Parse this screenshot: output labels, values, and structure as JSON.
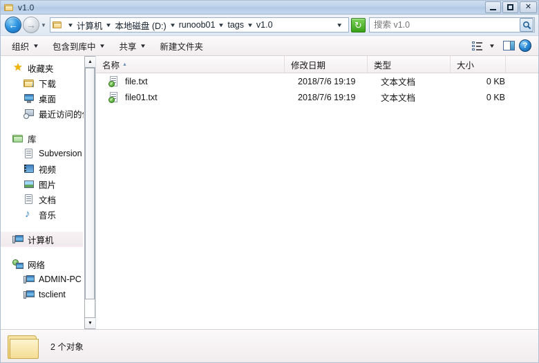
{
  "window": {
    "title": "v1.0",
    "title_icon": "folder-icon",
    "controls": {
      "minimize": "minimize-button",
      "maximize": "maximize-button",
      "close": "✕"
    }
  },
  "addressbar": {
    "back_label": "←",
    "forward_label": "→",
    "history_caret": "▼",
    "folder_icon": "folder-icon",
    "separator": "▼",
    "breadcrumbs": [
      "计算机",
      "本地磁盘 (D:)",
      "runoob01",
      "tags",
      "v1.0"
    ],
    "dropdown_caret": "▼",
    "refresh_label": "↻",
    "search": {
      "value": "",
      "placeholder": "搜索 v1.0",
      "button_icon": "search-icon"
    }
  },
  "toolbar": {
    "items": [
      {
        "label": "组织",
        "caret": "▼"
      },
      {
        "label": "包含到库中",
        "caret": "▼"
      },
      {
        "label": "共享",
        "caret": "▼"
      },
      {
        "label": "新建文件夹",
        "caret": ""
      }
    ],
    "view_caret": "▼",
    "help_label": "?"
  },
  "sidebar": {
    "groups": [
      {
        "head": {
          "label": "收藏夹",
          "icon": "star-icon"
        },
        "children": [
          {
            "label": "下载",
            "icon": "download-folder-icon"
          },
          {
            "label": "桌面",
            "icon": "desktop-icon"
          },
          {
            "label": "最近访问的位置",
            "icon": "recent-places-icon"
          }
        ]
      },
      {
        "head": {
          "label": "库",
          "icon": "library-folder-icon"
        },
        "children": [
          {
            "label": "Subversion",
            "icon": "document-icon"
          },
          {
            "label": "视频",
            "icon": "video-icon"
          },
          {
            "label": "图片",
            "icon": "picture-icon"
          },
          {
            "label": "文档",
            "icon": "document-icon"
          },
          {
            "label": "音乐",
            "icon": "music-icon"
          }
        ]
      },
      {
        "head": {
          "label": "计算机",
          "icon": "computer-icon",
          "selected": true
        },
        "children": []
      },
      {
        "head": {
          "label": "网络",
          "icon": "network-icon"
        },
        "children": [
          {
            "label": "ADMIN-PC",
            "icon": "computer-icon"
          },
          {
            "label": "tsclient",
            "icon": "computer-icon"
          }
        ]
      }
    ],
    "scroll_up": "▲",
    "scroll_down": "▼"
  },
  "filelist": {
    "columns": [
      {
        "label": "名称",
        "sort": "▲"
      },
      {
        "label": "修改日期",
        "sort": ""
      },
      {
        "label": "类型",
        "sort": ""
      },
      {
        "label": "大小",
        "sort": ""
      }
    ],
    "rows": [
      {
        "name": "file.txt",
        "date": "2018/7/6 19:19",
        "type": "文本文档",
        "size": "0 KB",
        "icon": "text-document-icon",
        "overlay": "✓"
      },
      {
        "name": "file01.txt",
        "date": "2018/7/6 19:19",
        "type": "文本文档",
        "size": "0 KB",
        "icon": "text-document-icon",
        "overlay": "✓"
      }
    ]
  },
  "statusbar": {
    "icon": "folder-icon",
    "text": "2 个对象"
  },
  "colors": {
    "titlebar": "#bdd2ea",
    "accent_blue": "#2f95e0",
    "refresh_green": "#38a017",
    "overlay_green": "#3f9a22",
    "folder_yellow": "#f0d276"
  }
}
